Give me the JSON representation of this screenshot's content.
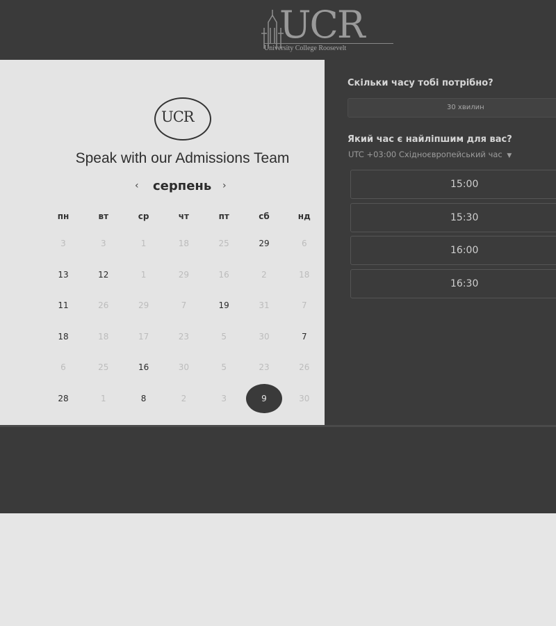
{
  "header": {
    "logo_text": "UCR",
    "logo_subtitle": "University College Roosevelt"
  },
  "scheduler": {
    "logo_text": "UCR",
    "title": "Speak with our Admissions Team",
    "month": "серпень",
    "prev_icon": "chevron-left-icon",
    "next_icon": "chevron-right-icon",
    "weekdays": [
      "пн",
      "вт",
      "ср",
      "чт",
      "пт",
      "сб",
      "нд"
    ],
    "weeks": [
      [
        {
          "d": "3",
          "a": false
        },
        {
          "d": "3",
          "a": false
        },
        {
          "d": "1",
          "a": false
        },
        {
          "d": "18",
          "a": false
        },
        {
          "d": "25",
          "a": false
        },
        {
          "d": "29",
          "a": true
        },
        {
          "d": "6",
          "a": false
        }
      ],
      [
        {
          "d": "13",
          "a": true
        },
        {
          "d": "12",
          "a": true
        },
        {
          "d": "1",
          "a": false
        },
        {
          "d": "29",
          "a": false
        },
        {
          "d": "16",
          "a": false
        },
        {
          "d": "2",
          "a": false
        },
        {
          "d": "18",
          "a": false
        }
      ],
      [
        {
          "d": "11",
          "a": true
        },
        {
          "d": "26",
          "a": false
        },
        {
          "d": "29",
          "a": false
        },
        {
          "d": "7",
          "a": false
        },
        {
          "d": "19",
          "a": true
        },
        {
          "d": "31",
          "a": false
        },
        {
          "d": "7",
          "a": false
        }
      ],
      [
        {
          "d": "18",
          "a": true
        },
        {
          "d": "18",
          "a": false
        },
        {
          "d": "17",
          "a": false
        },
        {
          "d": "23",
          "a": false
        },
        {
          "d": "5",
          "a": false
        },
        {
          "d": "30",
          "a": false
        },
        {
          "d": "7",
          "a": true
        }
      ],
      [
        {
          "d": "6",
          "a": false
        },
        {
          "d": "25",
          "a": false
        },
        {
          "d": "16",
          "a": true
        },
        {
          "d": "30",
          "a": false
        },
        {
          "d": "5",
          "a": false
        },
        {
          "d": "23",
          "a": false
        },
        {
          "d": "26",
          "a": false
        }
      ],
      [
        {
          "d": "28",
          "a": true
        },
        {
          "d": "1",
          "a": false
        },
        {
          "d": "8",
          "a": true
        },
        {
          "d": "2",
          "a": false
        },
        {
          "d": "3",
          "a": false
        },
        {
          "d": "9",
          "a": true,
          "selected": true
        },
        {
          "d": "30",
          "a": false
        }
      ]
    ]
  },
  "booking": {
    "duration_question": "Скільки часу тобі потрібно?",
    "duration_value": "30 хвилин",
    "time_question": "Який час є найліпшим для вас?",
    "timezone": "UTC +03:00 Східноєвропейський час",
    "timezone_icon": "caret-down-icon",
    "slots": [
      "15:00",
      "15:30",
      "16:00",
      "16:30"
    ]
  }
}
